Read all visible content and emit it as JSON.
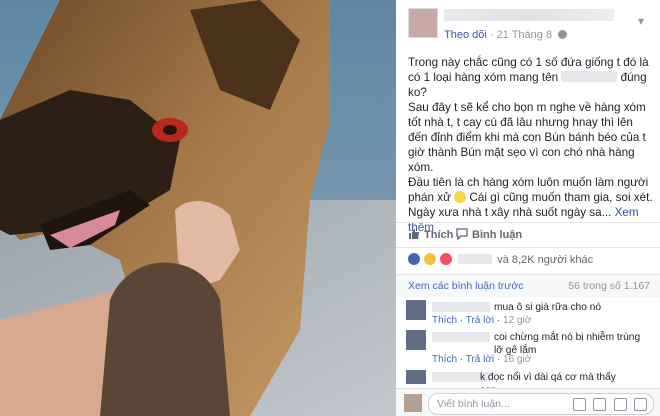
{
  "post": {
    "follow_label": "Theo dõi",
    "date": "21 Tháng 8",
    "text_line1": "Trong này chắc cũng có 1 số đứa giống t đó là có 1 loại hàng xóm mang tên",
    "text_line1b": "đúng ko?",
    "text_para2": "Sau đây t sẽ kể cho bọn m nghe về hàng xóm tốt nhà t, t cay cú đã lâu nhưng hnay thì lên đến đỉnh điểm khi mà con Bún bánh béo của t giờ thành Bún mặt sẹo vì con chó nhà hàng xóm.",
    "text_para3a": "Đầu tiên là ch hàng xóm luôn muốn làm người phán xử",
    "text_para3b": "Cái gì cũng muốn tham gia, soi xét. Ngày xưa nhà t xây nhà suốt ngày sa...",
    "see_more": "Xem thêm"
  },
  "actions": {
    "like": "Thích",
    "comment": "Bình luận"
  },
  "reactions": {
    "suffix": "và 8,2K người khác"
  },
  "comments_bar": {
    "see_previous": "Xem các bình luận trước",
    "count": "56 trong số 1.167"
  },
  "comments": [
    {
      "text": "mua ô si già rữa cho nó",
      "like": "Thích",
      "reply": "Trả lời",
      "time": "12 giờ"
    },
    {
      "text": "coi chừng mắt nó bị nhiễm trùng lỡ gê lắm",
      "like": "Thích",
      "reply": "Trả lời",
      "time": "16 giờ"
    },
    {
      "text": "k đọc nổi vì dài qá cơ mà thấy con"
    }
  ],
  "comment_input": {
    "placeholder": "Viết bình luận..."
  },
  "icons": [
    "chevron-down-icon",
    "globe-icon",
    "like-icon",
    "comment-icon",
    "camera-icon",
    "gif-icon",
    "sticker-icon"
  ],
  "colors": {
    "link": "#365899",
    "brand": "#4267b2",
    "muted": "#90949c"
  }
}
